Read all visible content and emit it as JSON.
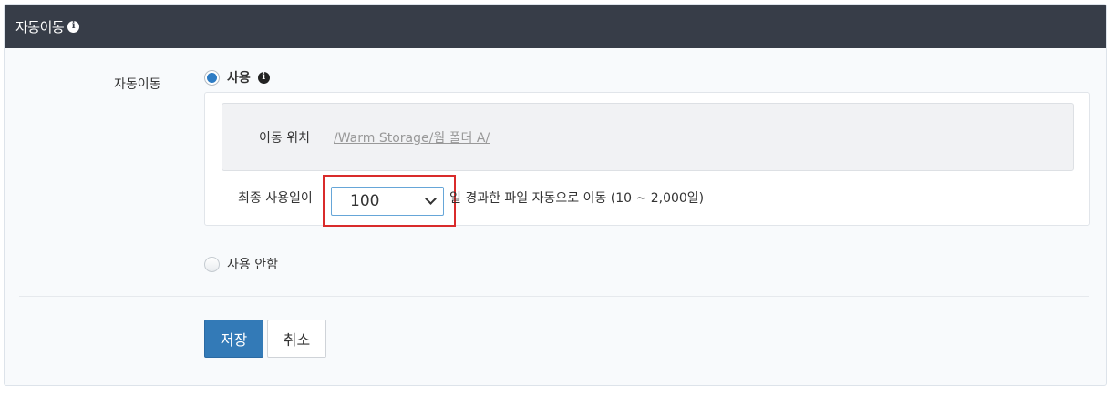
{
  "header": {
    "title": "자동이동",
    "info_icon": "i"
  },
  "form": {
    "label": "자동이동",
    "option_enabled": {
      "label": "사용",
      "selected": true,
      "info_icon": "i"
    },
    "move_location": {
      "label": "이동 위치",
      "path": "/Warm Storage/웜 폴더 A/"
    },
    "days": {
      "prefix": "최종 사용일이",
      "value": "100",
      "suffix": "일 경과한 파일 자동으로 이동 (10 ~ 2,000일)"
    },
    "option_disabled": {
      "label": "사용 안함",
      "selected": false
    }
  },
  "actions": {
    "save_label": "저장",
    "cancel_label": "취소"
  },
  "colors": {
    "header_bg": "#373d48",
    "primary": "#337ab7",
    "highlight": "#d92b2b",
    "link": "#999999"
  }
}
